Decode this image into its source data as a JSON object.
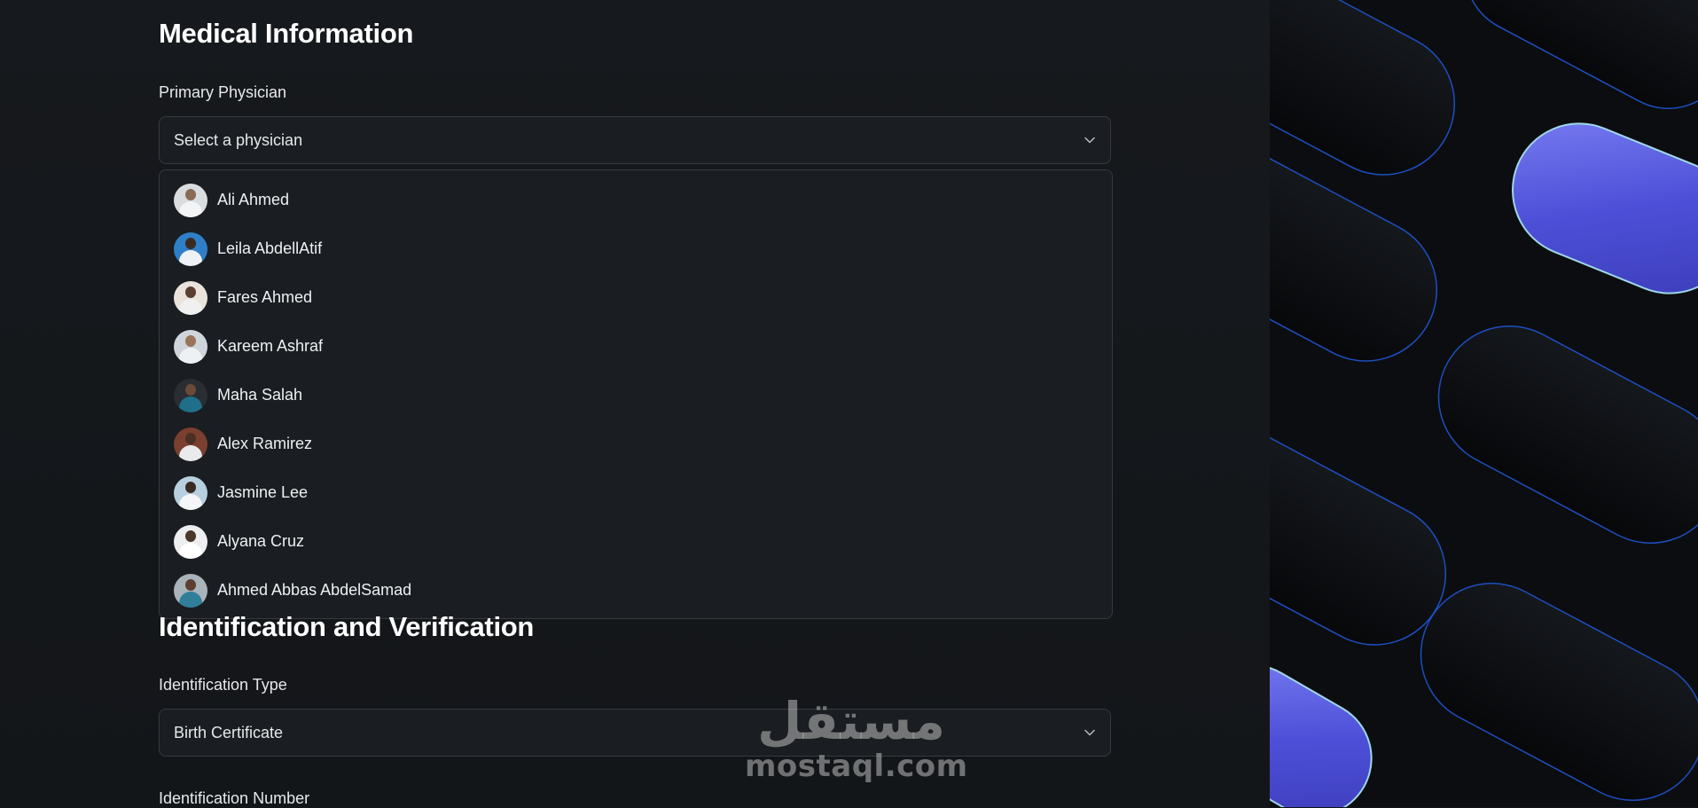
{
  "medical": {
    "title": "Medical Information",
    "physician_label": "Primary Physician",
    "physician_placeholder": "Select a physician"
  },
  "physicians": [
    {
      "name": "Ali Ahmed"
    },
    {
      "name": "Leila AbdellAtif"
    },
    {
      "name": "Fares Ahmed"
    },
    {
      "name": "Kareem Ashraf"
    },
    {
      "name": "Maha Salah"
    },
    {
      "name": "Alex Ramirez"
    },
    {
      "name": "Jasmine Lee"
    },
    {
      "name": "Alyana Cruz"
    },
    {
      "name": "Ahmed Abbas AbdelSamad"
    }
  ],
  "identification": {
    "title": "Identification and Verification",
    "type_label": "Identification Type",
    "type_value": "Birth Certificate",
    "number_label": "Identification Number"
  },
  "watermark": {
    "arabic": "مستقل",
    "latin": "mostaql.com"
  },
  "icons": {
    "dropdown": "chevron-down-icon",
    "avatar": "doctor-avatar"
  },
  "colors": {
    "background": "#131619",
    "field_background": "#1a1d21",
    "border": "#363a3f",
    "accent_purple": "#5a5ce0",
    "accent_blue": "#2a5cff"
  }
}
